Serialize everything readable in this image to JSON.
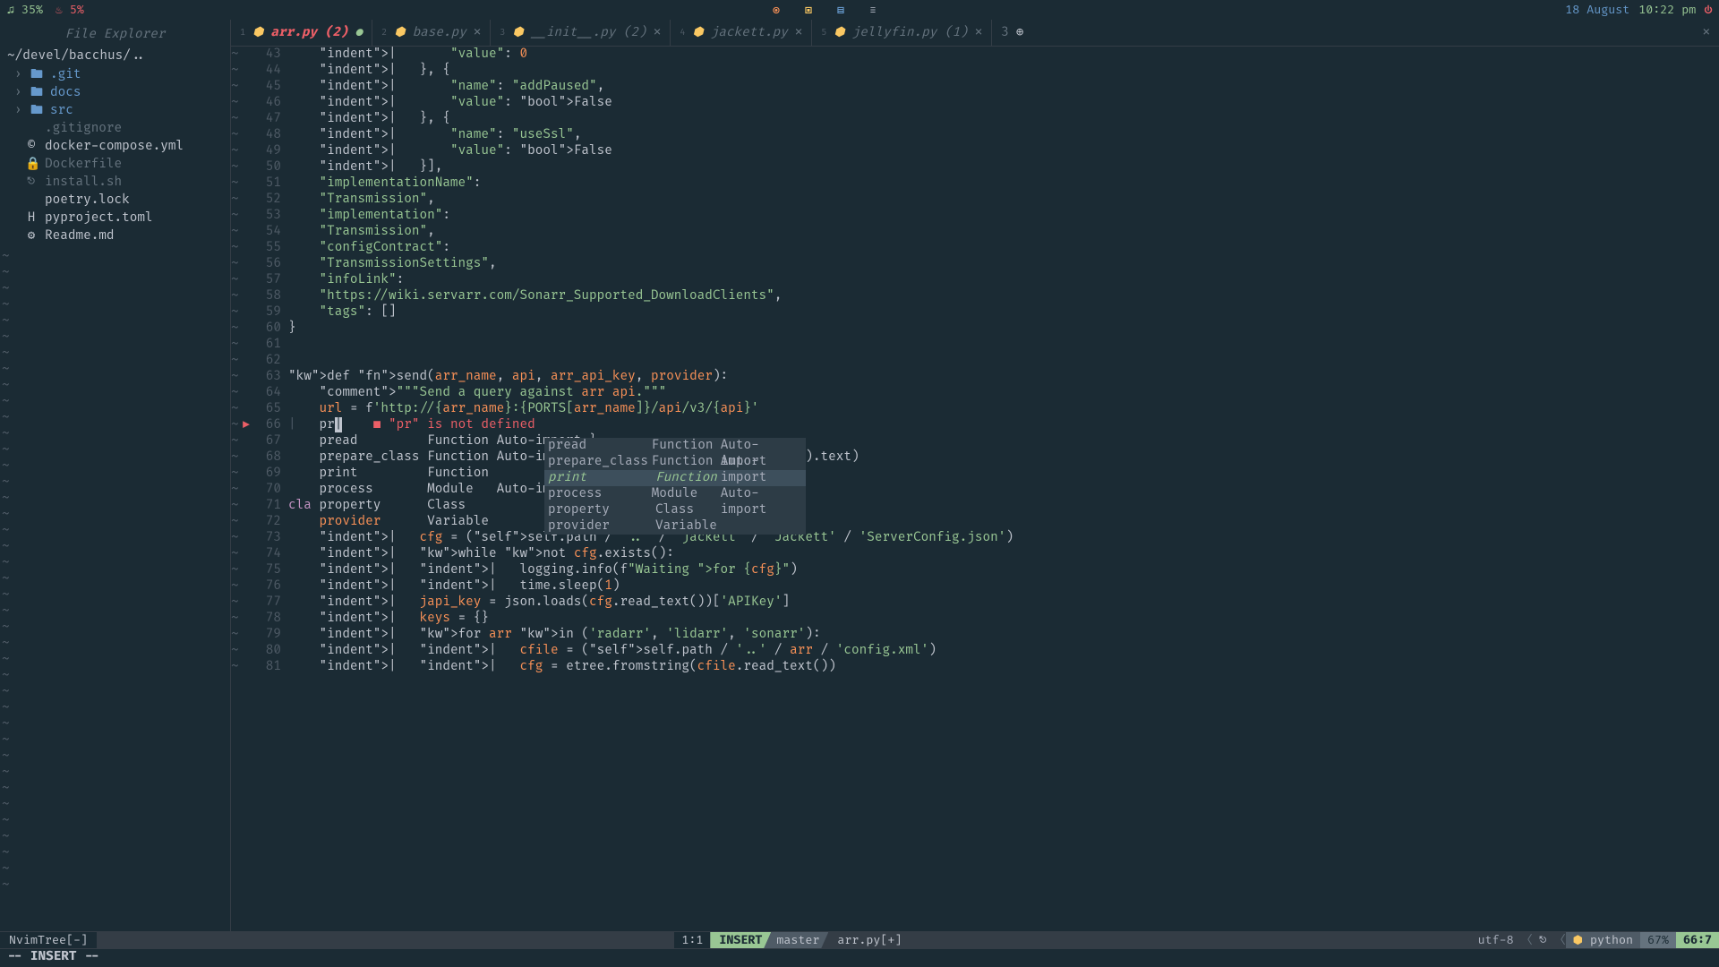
{
  "topbar": {
    "cpu": "♫ 35%",
    "mem": "♨ 5%",
    "date": "18 August",
    "time": "10:22 pm",
    "power": "⏻"
  },
  "sidebar": {
    "title": "File Explorer",
    "path": "~/devel/bacchus/..",
    "items": [
      {
        "label": ".git",
        "icon": "folder",
        "folder": true
      },
      {
        "label": "docs",
        "icon": "folder",
        "folder": true
      },
      {
        "label": "src",
        "icon": "folder",
        "folder": true
      },
      {
        "label": ".gitignore",
        "icon": "git",
        "dim": true
      },
      {
        "label": "docker-compose.yml",
        "icon": "copyright"
      },
      {
        "label": "Dockerfile",
        "icon": "lock",
        "dim": true
      },
      {
        "label": "install.sh",
        "icon": "shell",
        "dim": true
      },
      {
        "label": "poetry.lock",
        "icon": "blank"
      },
      {
        "label": "pyproject.toml",
        "icon": "H"
      },
      {
        "label": "Readme.md",
        "icon": "gear"
      }
    ]
  },
  "tabs": [
    {
      "num": "1",
      "name": "arr.py",
      "suffix": "(2)",
      "active": true,
      "modified": true
    },
    {
      "num": "2",
      "name": "base.py"
    },
    {
      "num": "3",
      "name": "__init__.py",
      "suffix": "(2)"
    },
    {
      "num": "4",
      "name": "jackett.py"
    },
    {
      "num": "5",
      "name": "jellyfin.py",
      "suffix": "(1)"
    }
  ],
  "tab_tail": {
    "count": "3",
    "plus": "⊕"
  },
  "code": {
    "lines": [
      {
        "n": 43,
        "t": "    |       \"value\": 0"
      },
      {
        "n": 44,
        "t": "    |   }, {"
      },
      {
        "n": 45,
        "t": "    |       \"name\": \"addPaused\","
      },
      {
        "n": 46,
        "t": "    |       \"value\": False"
      },
      {
        "n": 47,
        "t": "    |   }, {"
      },
      {
        "n": 48,
        "t": "    |       \"name\": \"useSsl\","
      },
      {
        "n": 49,
        "t": "    |       \"value\": False"
      },
      {
        "n": 50,
        "t": "    |   }],"
      },
      {
        "n": 51,
        "t": "    \"implementationName\":"
      },
      {
        "n": 52,
        "t": "    \"Transmission\","
      },
      {
        "n": 53,
        "t": "    \"implementation\":"
      },
      {
        "n": 54,
        "t": "    \"Transmission\","
      },
      {
        "n": 55,
        "t": "    \"configContract\":"
      },
      {
        "n": 56,
        "t": "    \"TransmissionSettings\","
      },
      {
        "n": 57,
        "t": "    \"infoLink\":"
      },
      {
        "n": 58,
        "t": "    \"https://wiki.servarr.com/Sonarr_Supported_DownloadClients\","
      },
      {
        "n": 59,
        "t": "    \"tags\": []"
      },
      {
        "n": 60,
        "t": "}"
      },
      {
        "n": 61,
        "t": ""
      },
      {
        "n": 62,
        "t": ""
      },
      {
        "n": 63,
        "t": "def send(arr_name, api, arr_api_key, provider):"
      },
      {
        "n": 64,
        "t": "    \"\"\"Send a query against arr api.\"\"\""
      },
      {
        "n": 65,
        "t": "    url = f'http://{arr_name}:{PORTS[arr_name]}/api/v3/{api}'"
      },
      {
        "n": 66,
        "t": "    pr|    ■ \"pr\" is not defined",
        "err": true
      },
      {
        "n": 67,
        "t": "    pread         Function Auto-import }"
      },
      {
        "n": 68,
        "t": "    prepare_class Function Auto-import aders=headers, json=provider).text)"
      },
      {
        "n": 69,
        "t": "    print         Function"
      },
      {
        "n": 70,
        "t": "    process       Module   Auto-import"
      },
      {
        "n": 71,
        "t": "cla property      Class"
      },
      {
        "n": 72,
        "t": "    provider      Variable"
      },
      {
        "n": 73,
        "t": "    |   cfg = (self.path / '..' / 'jackett' / 'Jackett' / 'ServerConfig.json')"
      },
      {
        "n": 74,
        "t": "    |   while not cfg.exists():"
      },
      {
        "n": 75,
        "t": "    |   |   logging.info(f\"Waiting for {cfg}\")"
      },
      {
        "n": 76,
        "t": "    |   |   time.sleep(1)"
      },
      {
        "n": 77,
        "t": "    |   japi_key = json.loads(cfg.read_text())['APIKey']"
      },
      {
        "n": 78,
        "t": "    |   keys = {}"
      },
      {
        "n": 79,
        "t": "    |   for arr in ('radarr', 'lidarr', 'sonarr'):"
      },
      {
        "n": 80,
        "t": "    |   |   cfile = (self.path / '..' / arr / 'config.xml')"
      },
      {
        "n": 81,
        "t": "    |   |   cfg = etree.fromstring(cfile.read_text())"
      }
    ]
  },
  "popup": {
    "rows": [
      {
        "c1": "pread",
        "c2": "Function",
        "c3": "Auto-import"
      },
      {
        "c1": "prepare_class",
        "c2": "Function",
        "c3": "Auto-import"
      },
      {
        "c1": "print",
        "c2": "Function",
        "c3": "",
        "sel": true
      },
      {
        "c1": "process",
        "c2": "Module",
        "c3": "Auto-import"
      },
      {
        "c1": "property",
        "c2": "Class",
        "c3": ""
      },
      {
        "c1": "provider",
        "c2": "Variable",
        "c3": ""
      }
    ]
  },
  "status": {
    "nvimtree": "NvimTree[-]",
    "pos_left": "1:1",
    "mode": "INSERT",
    "branch": " master",
    "file": "arr.py[+]",
    "enc": "utf-8",
    "lang": "python",
    "pct": "67%",
    "rc": "66:7"
  },
  "cmdline": "-- INSERT --"
}
